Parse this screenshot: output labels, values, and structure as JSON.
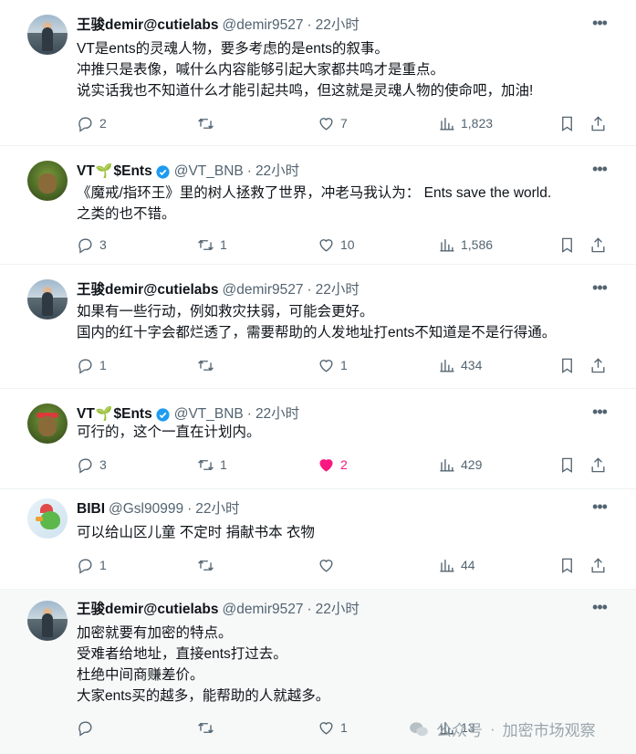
{
  "tweets": [
    {
      "name": "王骏demir@cutielabs",
      "handle": "@demir9527",
      "time": "22小时",
      "verified": false,
      "lines": [
        "VT是ents的灵魂人物，要多考虑的是ents的叙事。",
        "冲推只是表像，喊什么内容能够引起大家都共鸣才是重点。",
        "说实话我也不知道什么才能引起共鸣，但这就是灵魂人物的使命吧，加油!"
      ],
      "replies": "2",
      "retweets": "",
      "likes": "7",
      "views": "1,823",
      "liked": false
    },
    {
      "name": "VT",
      "name_suffix": "$Ents",
      "handle": "@VT_BNB",
      "time": "22小时",
      "verified": true,
      "lines": [
        "《魔戒/指环王》里的树人拯救了世界，冲老马我认为： Ents save the world.",
        "之类的也不错。"
      ],
      "replies": "3",
      "retweets": "1",
      "likes": "10",
      "views": "1,586",
      "liked": false
    },
    {
      "name": "王骏demir@cutielabs",
      "handle": "@demir9527",
      "time": "22小时",
      "verified": false,
      "lines": [
        "如果有一些行动，例如救灾扶弱，可能会更好。",
        "国内的红十字会都烂透了，需要帮助的人发地址打ents不知道是不是行得通。"
      ],
      "replies": "1",
      "retweets": "",
      "likes": "1",
      "views": "434",
      "liked": false
    },
    {
      "name": "VT",
      "name_suffix": "$Ents",
      "handle": "@VT_BNB",
      "time": "22小时",
      "verified": true,
      "lines": [
        "可行的，这个一直在计划内。"
      ],
      "replies": "3",
      "retweets": "1",
      "likes": "2",
      "views": "429",
      "liked": true
    },
    {
      "name": "BIBI",
      "handle": "@Gsl90999",
      "time": "22小时",
      "verified": false,
      "lines": [
        "可以给山区儿童 不定时 捐献书本 衣物"
      ],
      "replies": "1",
      "retweets": "",
      "likes": "",
      "views": "44",
      "liked": false
    },
    {
      "name": "王骏demir@cutielabs",
      "handle": "@demir9527",
      "time": "22小时",
      "verified": false,
      "lines": [
        "加密就要有加密的特点。",
        "受难者给地址，直接ents打过去。",
        "杜绝中间商赚差价。",
        "大家ents买的越多，能帮助的人就越多。"
      ],
      "replies": "",
      "retweets": "",
      "likes": "1",
      "views": "13",
      "liked": false
    }
  ],
  "separator": "·",
  "more_label": "•••",
  "watermark": {
    "left": "公众号",
    "dot": "·",
    "right": "加密市场观察"
  },
  "colors": {
    "text": "#0f1419",
    "secondary": "#536471",
    "like_active": "#f91880",
    "verified": "#1d9bf0",
    "highlight_bg": "#f7f9f9"
  }
}
